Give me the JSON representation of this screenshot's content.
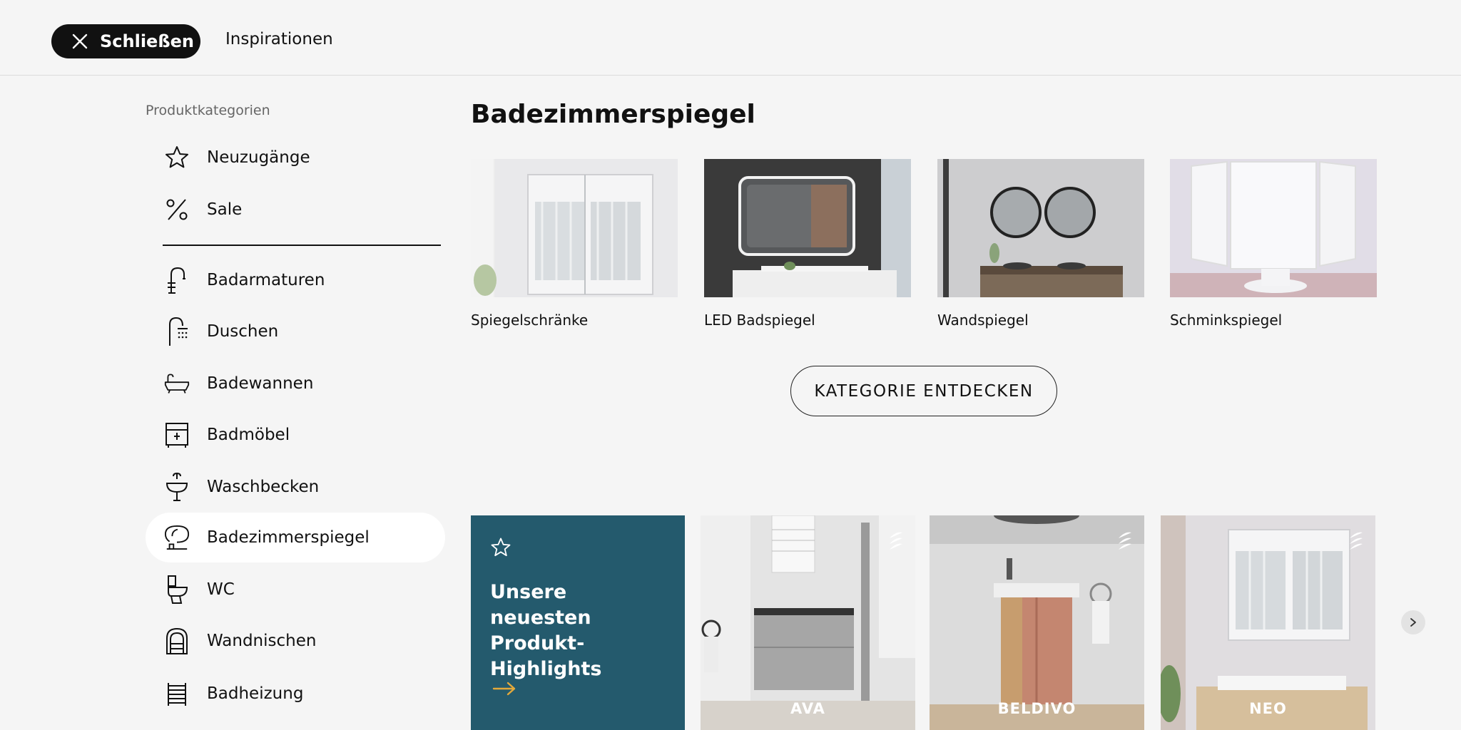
{
  "topbar": {
    "close_label": "Schließen",
    "inspirations_label": "Inspirationen"
  },
  "sidebar": {
    "heading": "Produktkategorien",
    "top_items": [
      {
        "label": "Neuzugänge",
        "icon": "star-icon"
      },
      {
        "label": "Sale",
        "icon": "percent-icon"
      }
    ],
    "items": [
      {
        "label": "Badarmaturen",
        "icon": "faucet-icon"
      },
      {
        "label": "Duschen",
        "icon": "shower-icon"
      },
      {
        "label": "Badewannen",
        "icon": "bathtub-icon"
      },
      {
        "label": "Badmöbel",
        "icon": "cabinet-icon"
      },
      {
        "label": "Waschbecken",
        "icon": "washbasin-icon"
      },
      {
        "label": "Badezimmerspiegel",
        "icon": "mirror-icon",
        "active": true
      },
      {
        "label": "WC",
        "icon": "toilet-icon"
      },
      {
        "label": "Wandnischen",
        "icon": "wall-niche-icon"
      },
      {
        "label": "Badheizung",
        "icon": "radiator-icon"
      }
    ]
  },
  "main": {
    "title": "Badezimmerspiegel",
    "subcategories": [
      {
        "label": "Spiegelschränke"
      },
      {
        "label": "LED Badspiegel"
      },
      {
        "label": "Wandspiegel"
      },
      {
        "label": "Schminkspiegel"
      }
    ],
    "discover_label": "KATEGORIE ENTDECKEN"
  },
  "highlights": {
    "promo_text": "Unsere neuesten Produkt-Highlights",
    "products": [
      {
        "name": "AVA"
      },
      {
        "name": "BELDIVO"
      },
      {
        "name": "NEO"
      }
    ]
  },
  "colors": {
    "promo_bg": "#245a6d",
    "promo_arrow": "#e3a93b",
    "close_bg": "#111111"
  }
}
